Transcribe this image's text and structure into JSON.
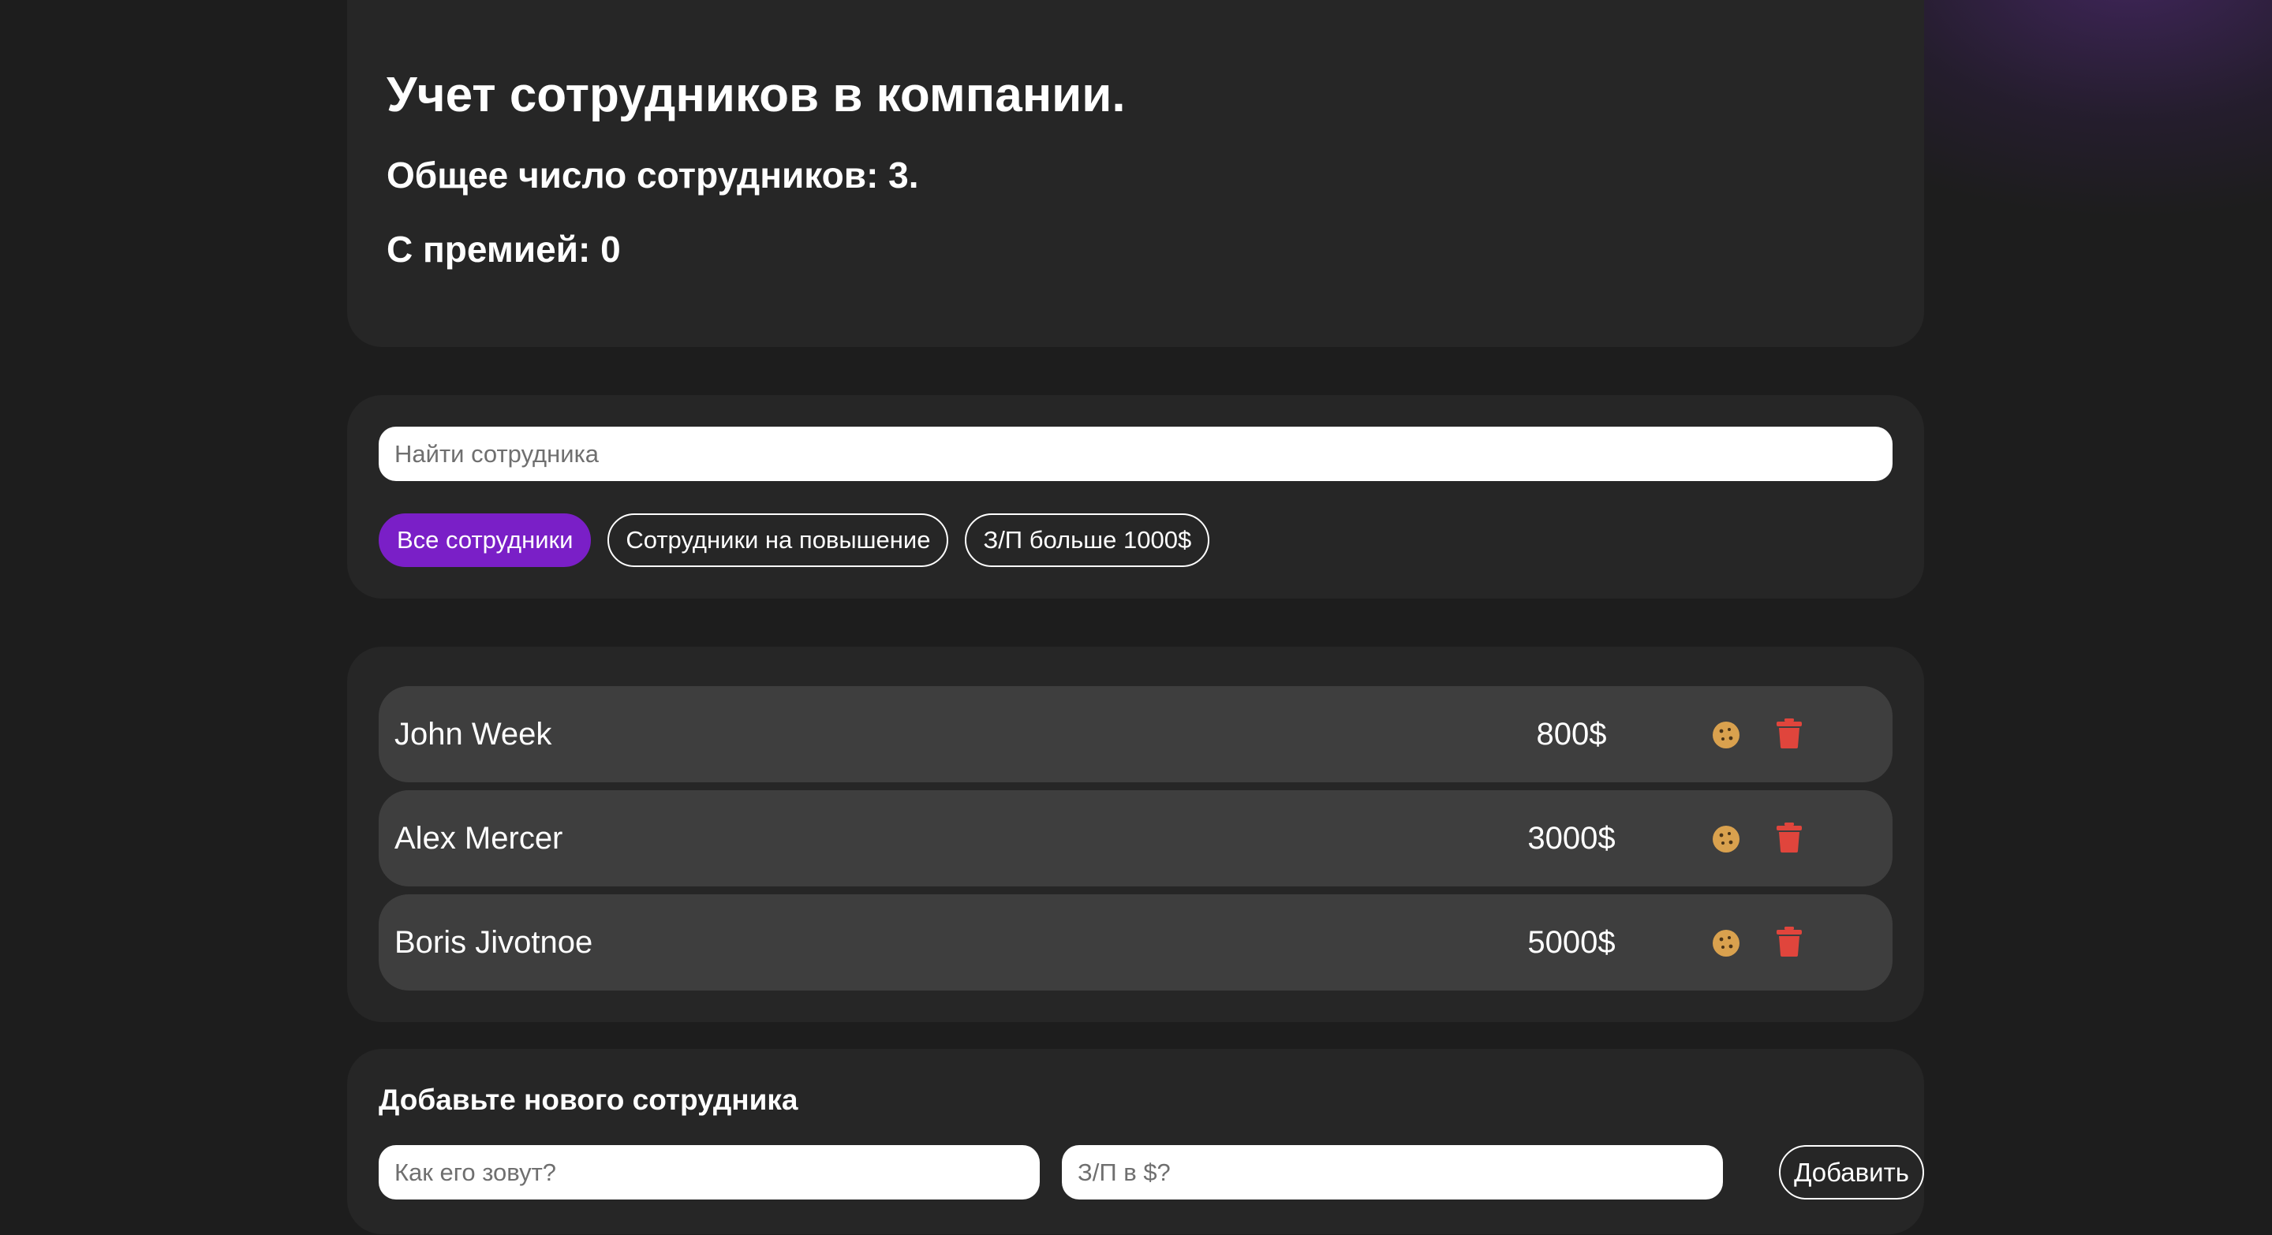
{
  "info": {
    "title": "Учет сотрудников в компании.",
    "total": "Общее число сотрудников: 3.",
    "bonus": "С премией: 0"
  },
  "search": {
    "placeholder": "Найти сотрудника"
  },
  "filters": [
    {
      "label": "Все сотрудники",
      "active": true
    },
    {
      "label": "Сотрудники на повышение",
      "active": false
    },
    {
      "label": "З/П больше 1000$",
      "active": false
    }
  ],
  "employees": [
    {
      "name": "John Week",
      "salary": "800$"
    },
    {
      "name": "Alex Mercer",
      "salary": "3000$"
    },
    {
      "name": "Boris Jivotnoe",
      "salary": "5000$"
    }
  ],
  "icons": {
    "cookie": "cookie-icon",
    "trash": "trash-icon"
  },
  "colors": {
    "accent": "#7a1fc7",
    "cookie": "#d9a14e",
    "trash": "#e0453c",
    "panel": "#262626",
    "row": "#3e3e3e"
  },
  "add_form": {
    "title": "Добавьте нового сотрудника",
    "name_placeholder": "Как его зовут?",
    "salary_placeholder": "З/П в $?",
    "submit_label": "Добавить"
  }
}
